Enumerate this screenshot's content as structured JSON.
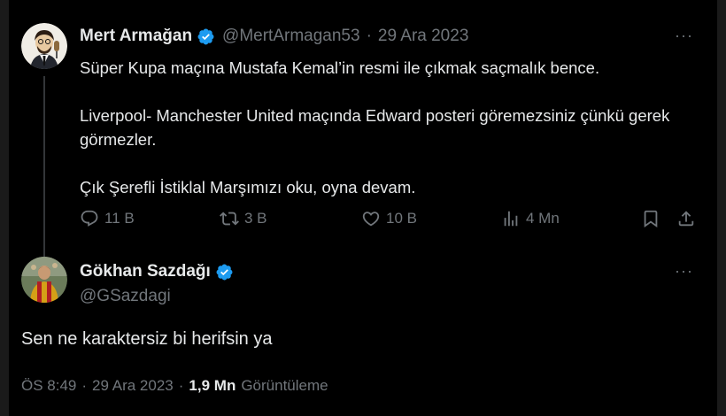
{
  "tweet1": {
    "author_name": "Mert Armağan",
    "handle": "@MertArmagan53",
    "date": "29 Ara 2023",
    "separator": "·",
    "more": "···",
    "body": [
      "Süper Kupa maçına Mustafa Kemal’in resmi ile çıkmak saçmalık bence.",
      "Liverpool- Manchester United maçında Edward posteri göremezsiniz çünkü gerek görmezler.",
      "Çık Şerefli İstiklal Marşımızı oku, oyna devam."
    ],
    "actions": {
      "replies": "11 B",
      "retweets": "3 B",
      "likes": "10 B",
      "views": "4 Mn"
    }
  },
  "tweet2": {
    "author_name": "Gökhan Sazdağı",
    "handle": "@GSazdagi",
    "more": "···",
    "body": "Sen ne karaktersiz bi herifsin ya",
    "time": "ÖS 8:49",
    "separator": "·",
    "date": "29 Ara 2023",
    "views_count": "1,9 Mn",
    "views_label": "Görüntüleme"
  },
  "colors": {
    "background": "#000000",
    "text": "#e7e9ea",
    "secondary": "#71767b",
    "verified": "#1d9bf0",
    "thread_line": "#333639"
  },
  "icons": {
    "reply": "reply-icon",
    "retweet": "retweet-icon",
    "like": "heart-icon",
    "views": "views-icon",
    "bookmark": "bookmark-icon",
    "share": "share-icon",
    "verified": "verified-badge-icon",
    "more": "more-icon"
  }
}
